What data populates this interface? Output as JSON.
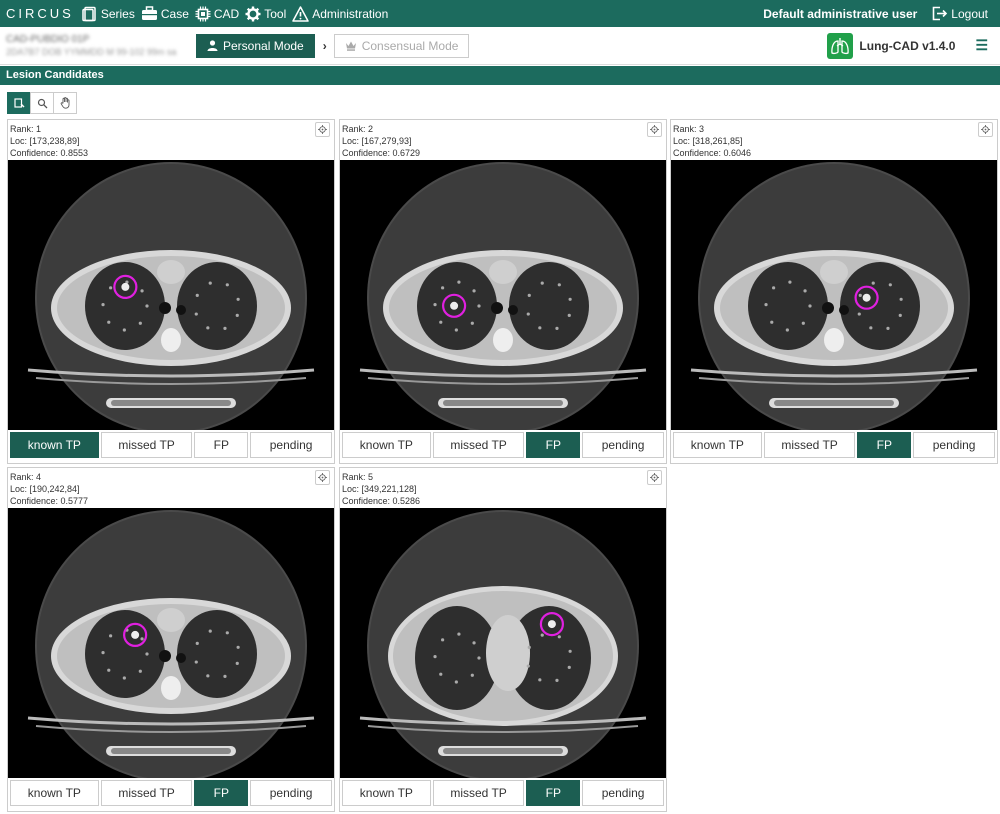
{
  "navbar": {
    "brand": "CIRCUS",
    "items": [
      "Series",
      "Case",
      "CAD",
      "Tool",
      "Administration"
    ],
    "user": "Default administrative user",
    "logout": "Logout"
  },
  "subheader": {
    "patient_line1": "CAD-PUBDIO 01P",
    "patient_line2": "2DA7B7 DOB YYMMDD M 99-102 99m sa",
    "personal_mode": "Personal Mode",
    "consensual_mode": "Consensual Mode",
    "plugin_name": "Lung-CAD v1.4.0"
  },
  "section_title": "Lesion Candidates",
  "feedback_options": [
    "known TP",
    "missed TP",
    "FP",
    "pending"
  ],
  "candidates": [
    {
      "rank": "Rank: 1",
      "loc": "Loc: [173,238,89]",
      "confidence": "Confidence: 0.8553",
      "selected": "known TP",
      "marker": [
        0.36,
        0.47
      ]
    },
    {
      "rank": "Rank: 2",
      "loc": "Loc: [167,279,93]",
      "confidence": "Confidence: 0.6729",
      "selected": "FP",
      "marker": [
        0.35,
        0.54
      ]
    },
    {
      "rank": "Rank: 3",
      "loc": "Loc: [318,261,85]",
      "confidence": "Confidence: 0.6046",
      "selected": "FP",
      "marker": [
        0.6,
        0.51
      ]
    },
    {
      "rank": "Rank: 4",
      "loc": "Loc: [190,242,84]",
      "confidence": "Confidence: 0.5777",
      "selected": "FP",
      "marker": [
        0.39,
        0.47
      ]
    },
    {
      "rank": "Rank: 5",
      "loc": "Loc: [349,221,128]",
      "confidence": "Confidence: 0.5286",
      "selected": "FP",
      "marker": [
        0.65,
        0.43
      ]
    }
  ],
  "colors": {
    "primary": "#1c6b5e",
    "active_button": "#1c5e52",
    "marker": "#e020e0",
    "plugin_icon": "#21a04a"
  }
}
